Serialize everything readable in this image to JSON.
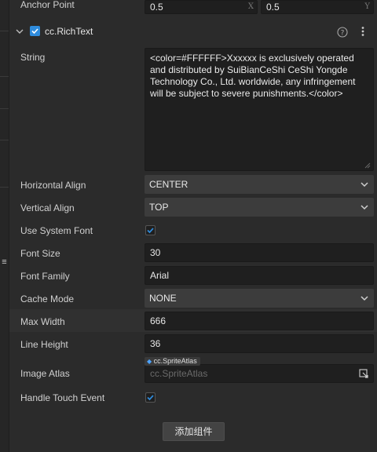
{
  "anchor": {
    "label": "Anchor Point",
    "x": "0.5",
    "y": "0.5",
    "x_axis": "X",
    "y_axis": "Y"
  },
  "component": {
    "title": "cc.RichText",
    "enabled": true,
    "help_icon": "question-circle-icon",
    "menu_icon": "vertical-ellipsis-icon"
  },
  "props": {
    "string": {
      "label": "String",
      "value": "<color=#FFFFFF>Xxxxxx is exclusively operated and distributed by SuiBianCeShi CeShi Yongde Technology Co., Ltd. worldwide, any infringement will be subject to severe punishments.</color>"
    },
    "h_align": {
      "label": "Horizontal Align",
      "value": "CENTER"
    },
    "v_align": {
      "label": "Vertical Align",
      "value": "TOP"
    },
    "sys_font": {
      "label": "Use System Font",
      "checked": true
    },
    "font_size": {
      "label": "Font Size",
      "value": "30"
    },
    "font_family": {
      "label": "Font Family",
      "value": "Arial"
    },
    "cache_mode": {
      "label": "Cache Mode",
      "value": "NONE"
    },
    "max_width": {
      "label": "Max Width",
      "value": "666"
    },
    "line_height": {
      "label": "Line Height",
      "value": "36"
    },
    "image_atlas": {
      "label": "Image Atlas",
      "type_tag": "cc.SpriteAtlas",
      "placeholder": "cc.SpriteAtlas"
    },
    "touch": {
      "label": "Handle Touch Event",
      "checked": true
    }
  },
  "add_component_label": "添加组件",
  "colors": {
    "accent": "#2f8cdd",
    "panel": "#2b2b2b",
    "field": "#1f1f1f",
    "select": "#3c3c3c"
  }
}
